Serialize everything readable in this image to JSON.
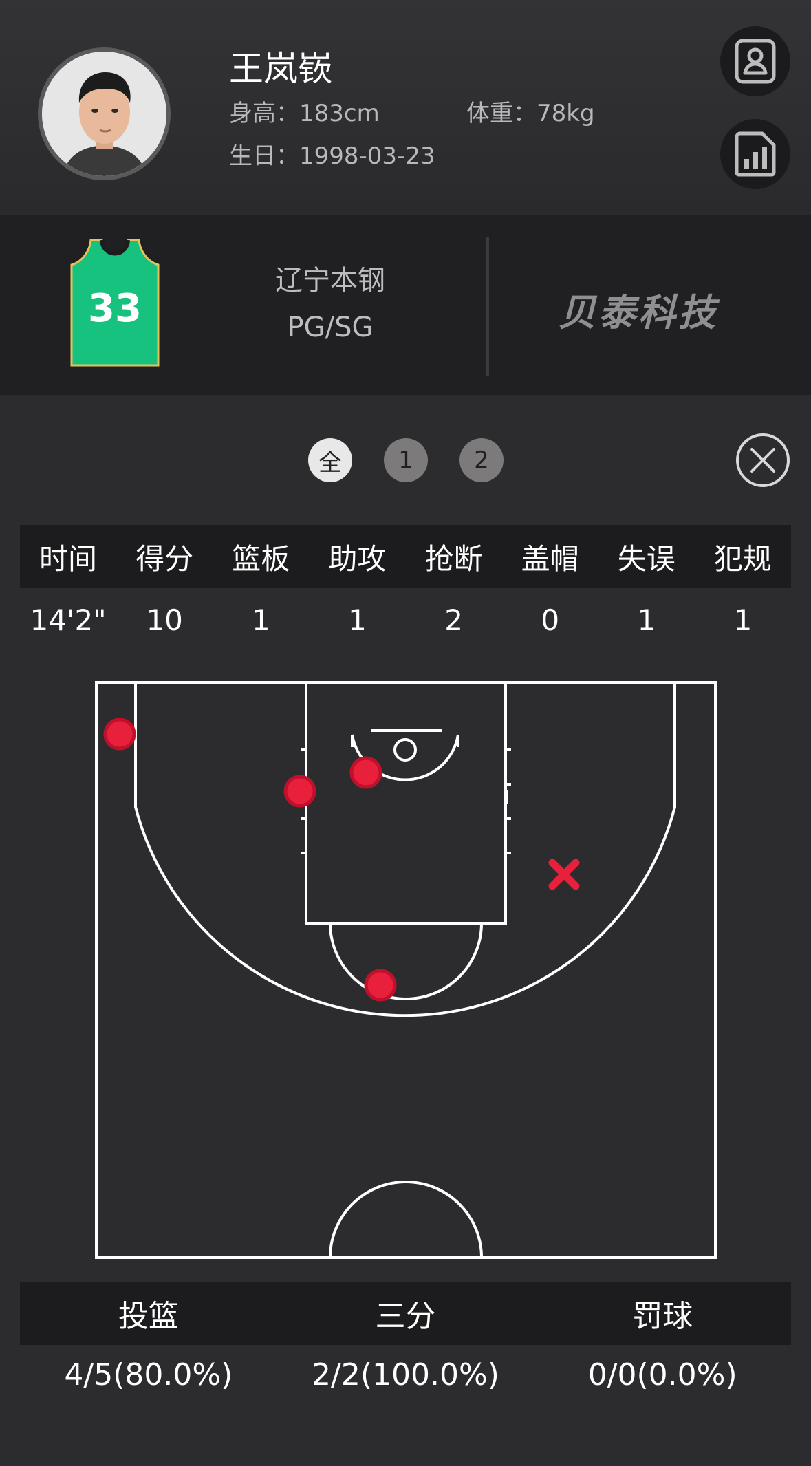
{
  "player": {
    "name": "王岚嵚",
    "height_label": "身高：",
    "height": "183cm",
    "weight_label": "体重：",
    "weight": "78kg",
    "birthday_label": "生日：",
    "birthday": "1998-03-23"
  },
  "header_actions": {
    "profile_icon": "person-card-icon",
    "stats_icon": "bar-chart-document-icon"
  },
  "team": {
    "name": "辽宁本钢",
    "position": "PG/SG",
    "jersey_number": "33",
    "jersey_color": "#17c27f",
    "sponsor": "贝泰科技"
  },
  "periods": [
    {
      "label": "全",
      "active": true
    },
    {
      "label": "1",
      "active": false
    },
    {
      "label": "2",
      "active": false
    }
  ],
  "close_icon": "close-circle-icon",
  "stats": {
    "headers": [
      "时间",
      "得分",
      "篮板",
      "助攻",
      "抢断",
      "盖帽",
      "失误",
      "犯规"
    ],
    "values": [
      "14'2\"",
      "10",
      "1",
      "1",
      "2",
      "0",
      "1",
      "1"
    ]
  },
  "shots": {
    "made_color": "#e8203c",
    "items": [
      {
        "result": "made"
      },
      {
        "result": "made"
      },
      {
        "result": "made"
      },
      {
        "result": "made"
      },
      {
        "result": "missed"
      }
    ]
  },
  "shooting": {
    "headers": [
      "投篮",
      "三分",
      "罚球"
    ],
    "values": [
      "4/5(80.0%)",
      "2/2(100.0%)",
      "0/0(0.0%)"
    ]
  }
}
